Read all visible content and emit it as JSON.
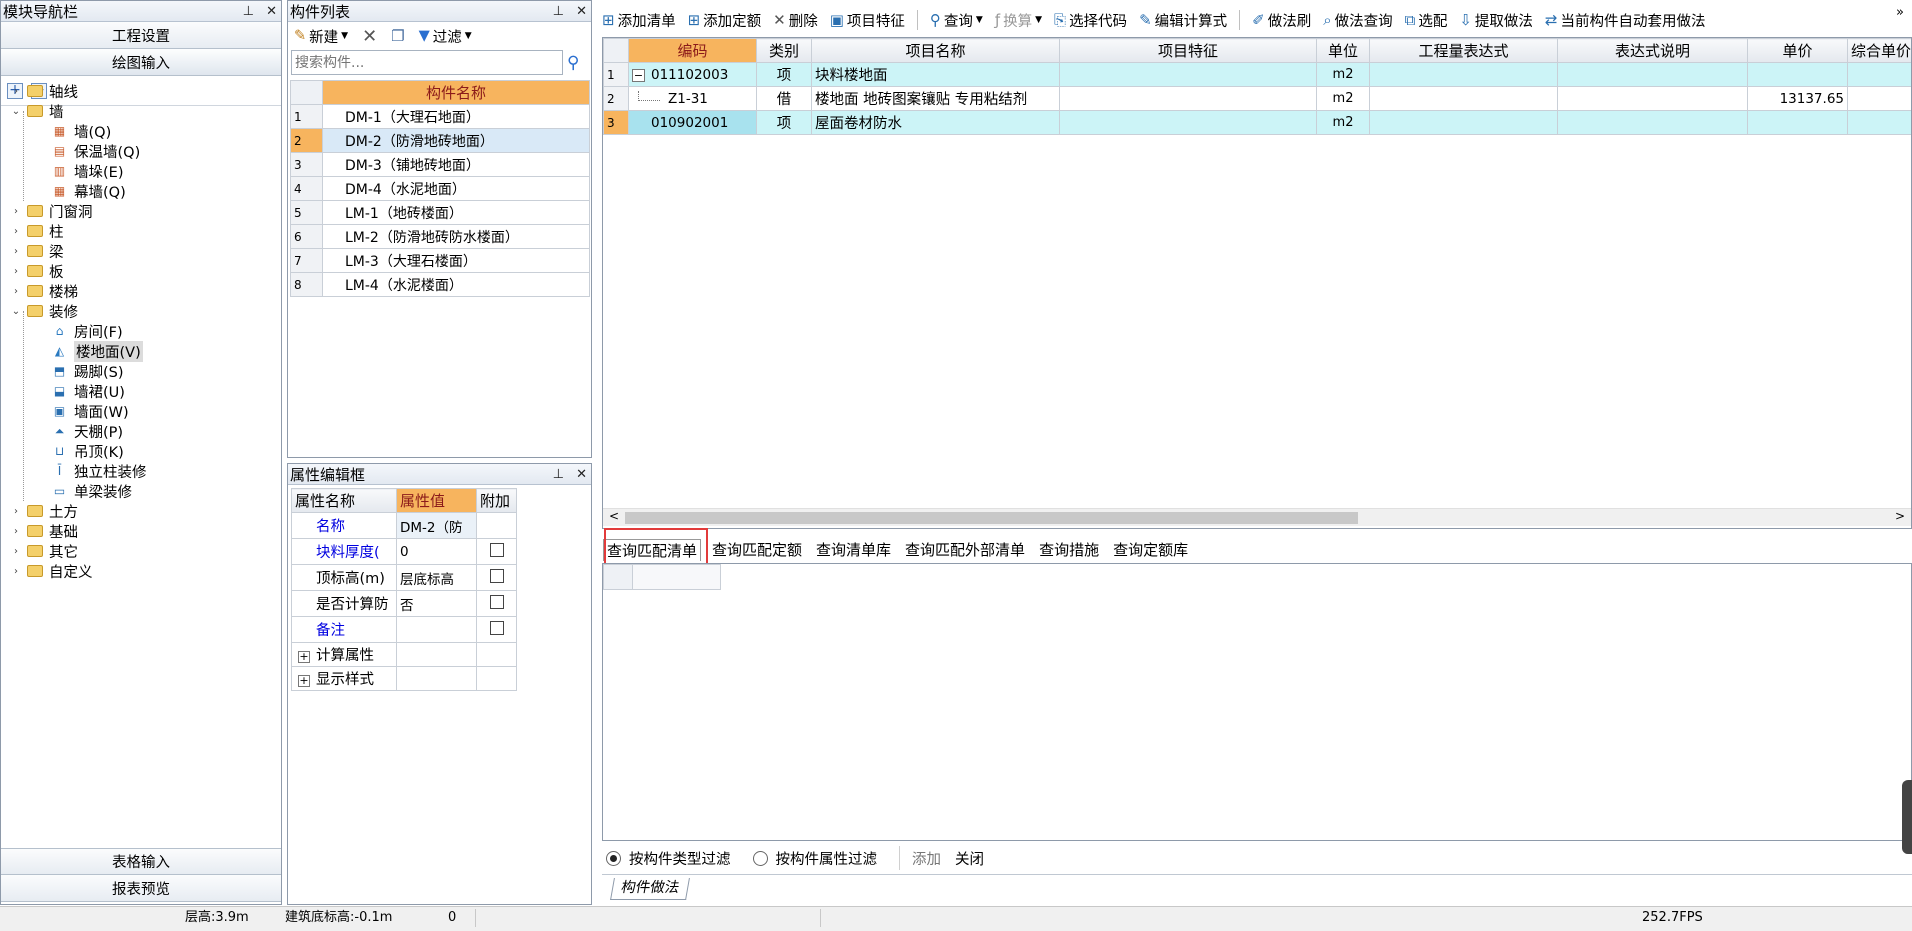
{
  "nav": {
    "title": "模块导航栏",
    "top_buttons": [
      "工程设置",
      "绘图输入"
    ],
    "bottom_buttons": [
      "表格输入",
      "报表预览"
    ],
    "tree": [
      {
        "label": "轴线",
        "level": 0,
        "expanded": false,
        "icon": "folder-icon"
      },
      {
        "label": "墙",
        "level": 0,
        "expanded": true,
        "icon": "folder-icon"
      },
      {
        "label": "墙(Q)",
        "level": 1,
        "icon": "wall-icon"
      },
      {
        "label": "保温墙(Q)",
        "level": 1,
        "icon": "insulation-wall-icon"
      },
      {
        "label": "墙垛(E)",
        "level": 1,
        "icon": "wall-pier-icon"
      },
      {
        "label": "幕墙(Q)",
        "level": 1,
        "icon": "curtain-wall-icon"
      },
      {
        "label": "门窗洞",
        "level": 0,
        "expanded": false,
        "icon": "folder-icon"
      },
      {
        "label": "柱",
        "level": 0,
        "expanded": false,
        "icon": "folder-icon"
      },
      {
        "label": "梁",
        "level": 0,
        "expanded": false,
        "icon": "folder-icon"
      },
      {
        "label": "板",
        "level": 0,
        "expanded": false,
        "icon": "folder-icon"
      },
      {
        "label": "楼梯",
        "level": 0,
        "expanded": false,
        "icon": "folder-icon"
      },
      {
        "label": "装修",
        "level": 0,
        "expanded": true,
        "icon": "folder-icon"
      },
      {
        "label": "房间(F)",
        "level": 1,
        "icon": "room-icon"
      },
      {
        "label": "楼地面(V)",
        "level": 1,
        "icon": "floor-icon",
        "selected": true
      },
      {
        "label": "踢脚(S)",
        "level": 1,
        "icon": "skirting-icon"
      },
      {
        "label": "墙裙(U)",
        "level": 1,
        "icon": "dado-icon"
      },
      {
        "label": "墙面(W)",
        "level": 1,
        "icon": "wall-surface-icon"
      },
      {
        "label": "天棚(P)",
        "level": 1,
        "icon": "ceiling-icon"
      },
      {
        "label": "吊顶(K)",
        "level": 1,
        "icon": "suspended-ceiling-icon"
      },
      {
        "label": "独立柱装修",
        "level": 1,
        "icon": "column-finish-icon"
      },
      {
        "label": "单梁装修",
        "level": 1,
        "icon": "beam-finish-icon"
      },
      {
        "label": "土方",
        "level": 0,
        "expanded": false,
        "icon": "folder-icon"
      },
      {
        "label": "基础",
        "level": 0,
        "expanded": false,
        "icon": "folder-icon"
      },
      {
        "label": "其它",
        "level": 0,
        "expanded": false,
        "icon": "folder-icon"
      },
      {
        "label": "自定义",
        "level": 0,
        "expanded": false,
        "icon": "folder-icon"
      }
    ]
  },
  "component_list": {
    "title": "构件列表",
    "new_label": "新建",
    "filter_label": "过滤",
    "search_placeholder": "搜索构件...",
    "column_header": "构件名称",
    "rows": [
      {
        "n": "1",
        "name": "DM-1（大理石地面）"
      },
      {
        "n": "2",
        "name": "DM-2（防滑地砖地面）",
        "selected": true
      },
      {
        "n": "3",
        "name": "DM-3（铺地砖地面）"
      },
      {
        "n": "4",
        "name": "DM-4（水泥地面）"
      },
      {
        "n": "5",
        "name": "LM-1（地砖楼面）"
      },
      {
        "n": "6",
        "name": "LM-2（防滑地砖防水楼面）"
      },
      {
        "n": "7",
        "name": "LM-3（大理石楼面）"
      },
      {
        "n": "8",
        "name": "LM-4（水泥楼面）"
      }
    ]
  },
  "props": {
    "title": "属性编辑框",
    "headers": [
      "属性名称",
      "属性值",
      "附加"
    ],
    "rows": [
      {
        "name": "名称",
        "value": "DM-2（防",
        "blue": true,
        "check": false
      },
      {
        "name": "块料厚度(",
        "value": "0",
        "blue": true,
        "check": true
      },
      {
        "name": "顶标高(m)",
        "value": "层底标高",
        "blue": false,
        "check": true
      },
      {
        "name": "是否计算防",
        "value": "否",
        "blue": false,
        "check": true
      },
      {
        "name": "备注",
        "value": "",
        "blue": true,
        "check": true
      }
    ],
    "groups": [
      "计算属性",
      "显示样式"
    ]
  },
  "toolbar": {
    "items": [
      "添加清单",
      "添加定额",
      "删除",
      "项目特征",
      "查询",
      "换算",
      "选择代码",
      "编辑计算式",
      "做法刷",
      "做法查询",
      "选配",
      "提取做法",
      "当前构件自动套用做法"
    ]
  },
  "grid": {
    "headers": [
      "编码",
      "类别",
      "项目名称",
      "项目特征",
      "单位",
      "工程量表达式",
      "表达式说明",
      "单价",
      "综合单价"
    ],
    "rows": [
      {
        "n": "1",
        "code": "011102003",
        "type": "项",
        "name": "块料楼地面",
        "unit": "m2",
        "price": "",
        "highlight": true,
        "collapse": "−"
      },
      {
        "n": "2",
        "code": "Z1-31",
        "type": "借",
        "name": "楼地面 地砖图案镶贴 专用粘结剂",
        "unit": "m2",
        "price": "13137.65",
        "highlight": false,
        "collapse": ""
      },
      {
        "n": "3",
        "code": "010902001",
        "type": "项",
        "name": "屋面卷材防水",
        "unit": "m2",
        "price": "",
        "highlight": true,
        "collapse": ""
      }
    ]
  },
  "query_tabs": [
    "查询匹配清单",
    "查询匹配定额",
    "查询清单库",
    "查询匹配外部清单",
    "查询措施",
    "查询定额库"
  ],
  "filter": {
    "by_type": "按构件类型过滤",
    "by_prop": "按构件属性过滤",
    "add": "添加",
    "close": "关闭"
  },
  "bottom_tab": "构件做法",
  "status": {
    "floor_height": "层高:3.9m",
    "base_elev": "建筑底标高:-0.1m",
    "zero": "0",
    "fps": "252.7FPS"
  },
  "colors": {
    "accent": "#f7b45e",
    "row_highlight": "#ccf4f7",
    "selected_row": "#d9e9f7",
    "red_box": "#e23b3b",
    "blue_text": "#0000e0"
  }
}
